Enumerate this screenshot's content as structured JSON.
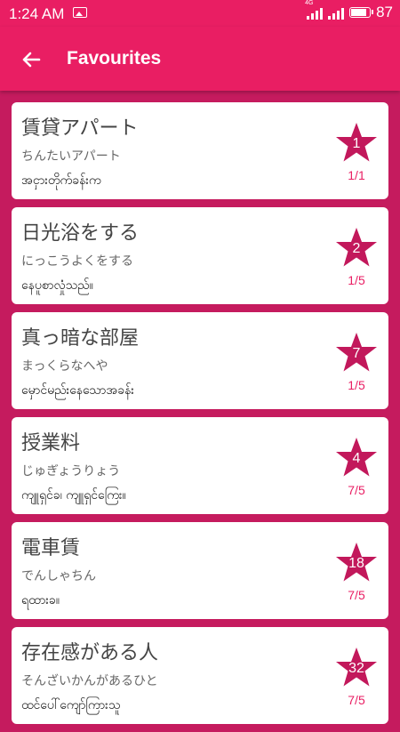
{
  "status_bar": {
    "time": "1:24 AM",
    "network_label": "4G",
    "battery_level": "87",
    "icons": [
      "image-icon",
      "signal-icon",
      "signal-icon",
      "battery-icon"
    ]
  },
  "app_bar": {
    "title": "Favourites",
    "back_icon": "arrow-back-icon"
  },
  "colors": {
    "primary": "#e91e63",
    "background": "#c51b5e",
    "star": "#c2185b"
  },
  "favourites": [
    {
      "kanji": "賃貸アパート",
      "kana": "ちんたいアパート",
      "meaning": "အငှားတိုက်ခန်းက",
      "count": "1",
      "ratio": "1/1"
    },
    {
      "kanji": "日光浴をする",
      "kana": "にっこうよくをする",
      "meaning": "နေပူစာလှုံသည်။",
      "count": "2",
      "ratio": "1/5"
    },
    {
      "kanji": "真っ暗な部屋",
      "kana": "まっくらなへや",
      "meaning": "မှောင်မည်းနေသောအခန်း",
      "count": "7",
      "ratio": "1/5"
    },
    {
      "kanji": "授業料",
      "kana": "じゅぎょうりょう",
      "meaning": "ကျူရှင်ခ၊ ကျူရှင်ကြေး။",
      "count": "4",
      "ratio": "7/5"
    },
    {
      "kanji": "電車賃",
      "kana": "でんしゃちん",
      "meaning": "ရထားခ။",
      "count": "18",
      "ratio": "7/5"
    },
    {
      "kanji": "存在感がある人",
      "kana": "そんざいかんがあるひと",
      "meaning": "ထင်ပေါ်ကျော်ကြားသူ",
      "count": "32",
      "ratio": "7/5"
    }
  ]
}
